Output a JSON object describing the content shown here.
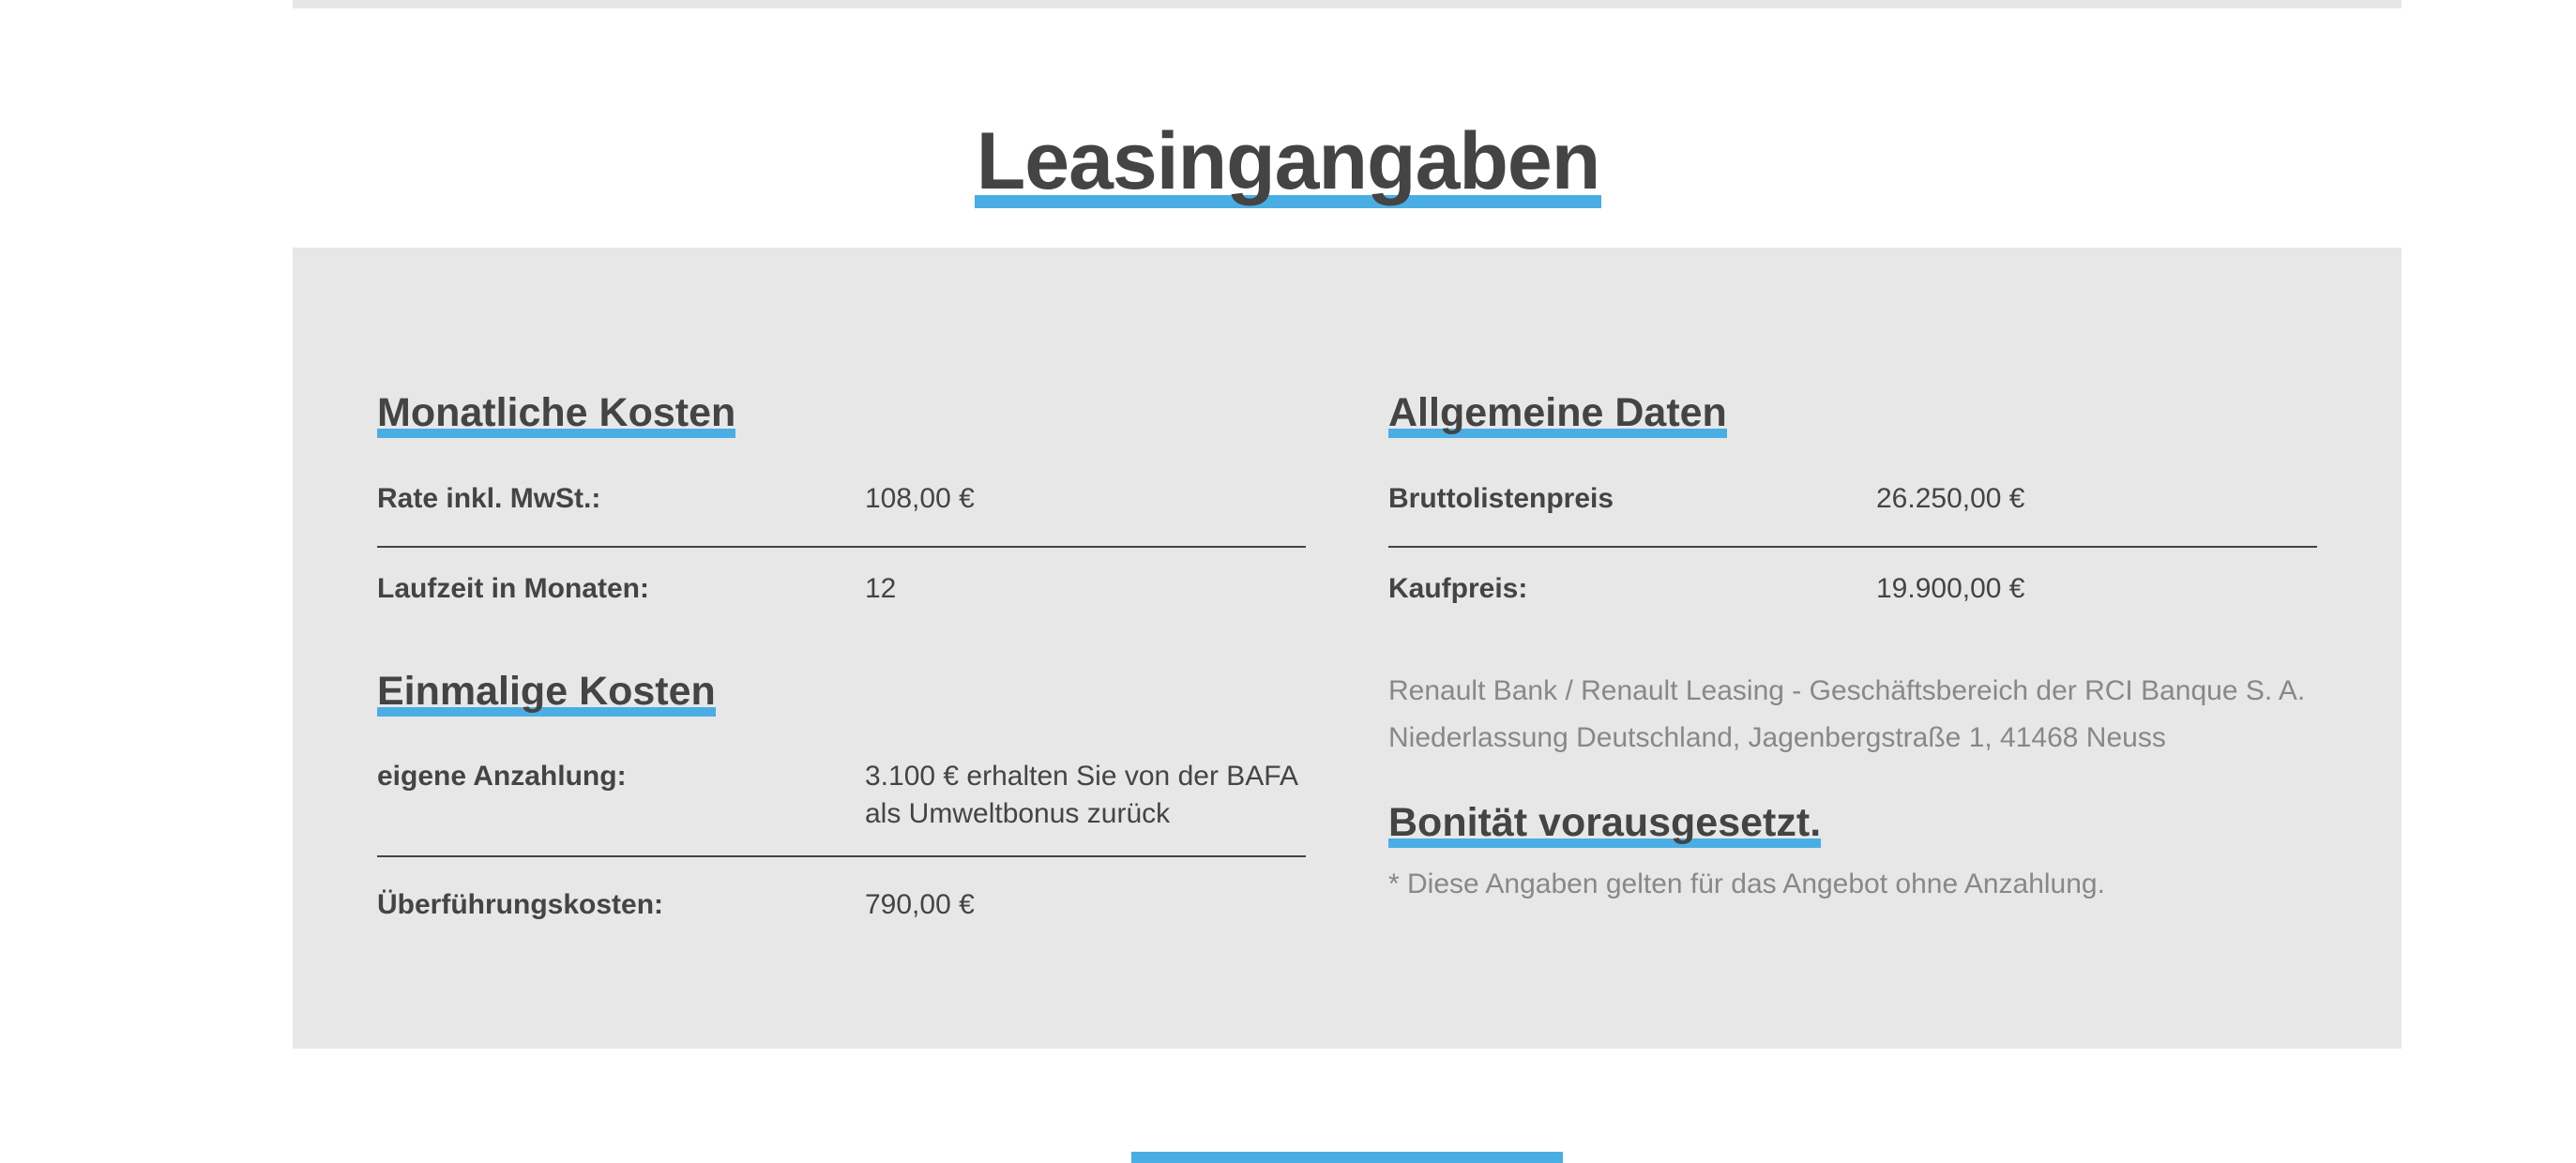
{
  "page": {
    "title": "Leasingangaben"
  },
  "monthly": {
    "title": "Monatliche Kosten",
    "rows": [
      {
        "label": "Rate inkl. MwSt.:",
        "value": "108,00 €"
      },
      {
        "label": "Laufzeit in Monaten:",
        "value": "12"
      }
    ]
  },
  "onetime": {
    "title": "Einmalige Kosten",
    "rows": [
      {
        "label": "eigene Anzahlung:",
        "value": "3.100 € erhalten Sie von der BAFA als Umweltbonus zurück"
      },
      {
        "label": "Überführungskosten:",
        "value": "790,00 €"
      }
    ]
  },
  "general": {
    "title": "Allgemeine Daten",
    "rows": [
      {
        "label": "Bruttolistenpreis",
        "value": "26.250,00 €"
      },
      {
        "label": "Kaufpreis:",
        "value": "19.900,00 €"
      }
    ],
    "lender": "Renault Bank / Renault Leasing - Geschäftsbereich der RCI Banque S. A. Niederlassung Deutschland, Jagenbergstraße 1, 41468 Neuss"
  },
  "credit": {
    "title": "Bonität vorausgesetzt.",
    "note": "* Diese Angaben gelten für das Angebot ohne Anzahlung."
  },
  "colors": {
    "accent": "#4aaee5",
    "panel": "#e7e7e7",
    "text": "#444444",
    "muted": "#888888"
  }
}
